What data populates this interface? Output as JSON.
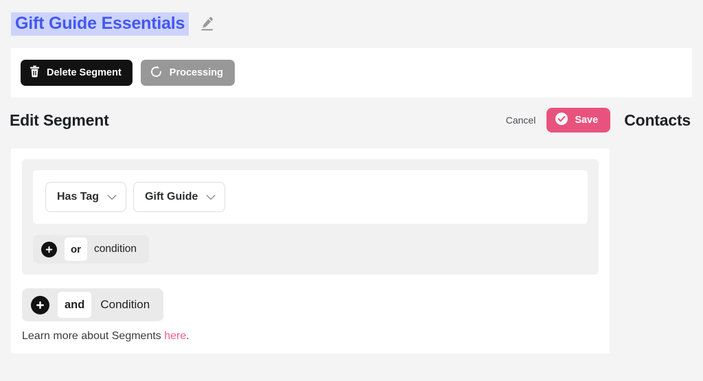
{
  "header": {
    "segment_name": "Gift Guide Essentials",
    "edit_icon": "pencil-icon"
  },
  "toolbar": {
    "delete_label": "Delete Segment",
    "delete_icon": "trash-icon",
    "processing_label": "Processing",
    "processing_icon": "refresh-spinner-icon"
  },
  "edit_header": {
    "title": "Edit Segment",
    "cancel_label": "Cancel",
    "save_label": "Save",
    "save_icon": "check-circle-icon",
    "contacts_title": "Contacts"
  },
  "segment_builder": {
    "condition": {
      "operator_value": "Has Tag",
      "value_value": "Gift Guide",
      "chevron_icon": "chevron-down-icon"
    },
    "add_or": {
      "plus_icon": "plus-circle-icon",
      "chip": "or",
      "label": "condition"
    },
    "add_and": {
      "plus_icon": "plus-circle-icon",
      "chip": "and",
      "label": "Condition"
    },
    "help": {
      "text_before": "Learn more about Segments ",
      "link_text": "here",
      "text_after": "."
    }
  },
  "colors": {
    "accent_pink": "#e8537e",
    "link_pink": "#ef5f86",
    "title_blue": "#4457f2",
    "title_highlight": "#ccd4fb",
    "dark": "#121212",
    "processing_gray": "#989898",
    "page_bg": "#f4f4f5"
  }
}
